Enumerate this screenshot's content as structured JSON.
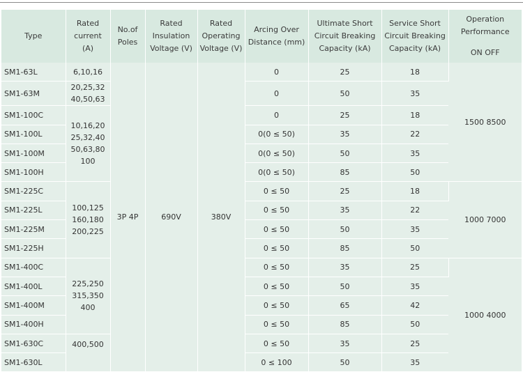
{
  "headers": {
    "type": "Type",
    "rated_current": "Rated current (A)",
    "poles": "No.of Poles",
    "insulation": "Rated Insulation Voltage (V)",
    "operating": "Rated Operating Voltage (V)",
    "arcing": "Arcing Over Distance (mm)",
    "ultimate": "Ultimate Short Circuit Breaking Capacity (kA)",
    "service": "Service Short Circuit Breaking Capacity (kA)",
    "operation": "Operation Performance",
    "operation_sub": "ON OFF"
  },
  "shared": {
    "poles": "3P 4P",
    "insulation": "690V",
    "operating": "380V"
  },
  "currents": {
    "g1a": "6,10,16",
    "g1b": "20,25,32 40,50,63",
    "g2": "10,16,20 25,32,40 50,63,80 100",
    "g3": "100,125 160,180 200,225",
    "g4": "225,250 315,350 400",
    "g5": "400,500"
  },
  "operation": {
    "op1": "1500 8500",
    "op2": "1000 7000",
    "op3": "1000 4000"
  },
  "rows": [
    {
      "type": "SM1-63L",
      "arc": "0",
      "ult": "25",
      "svc": "18"
    },
    {
      "type": "SM1-63M",
      "arc": "0",
      "ult": "50",
      "svc": "35"
    },
    {
      "type": "SM1-100C",
      "arc": "0",
      "ult": "25",
      "svc": "18"
    },
    {
      "type": "SM1-100L",
      "arc": "0(0 ≤ 50)",
      "ult": "35",
      "svc": "22"
    },
    {
      "type": "SM1-100M",
      "arc": "0(0 ≤ 50)",
      "ult": "50",
      "svc": "35"
    },
    {
      "type": "SM1-100H",
      "arc": "0(0 ≤ 50)",
      "ult": "85",
      "svc": "50"
    },
    {
      "type": "SM1-225C",
      "arc": "0 ≤ 50",
      "ult": "25",
      "svc": "18"
    },
    {
      "type": "SM1-225L",
      "arc": "0 ≤ 50",
      "ult": "35",
      "svc": "22"
    },
    {
      "type": "SM1-225M",
      "arc": "0 ≤ 50",
      "ult": "50",
      "svc": "35"
    },
    {
      "type": "SM1-225H",
      "arc": "0 ≤ 50",
      "ult": "85",
      "svc": "50"
    },
    {
      "type": "SM1-400C",
      "arc": "0 ≤ 50",
      "ult": "35",
      "svc": "25"
    },
    {
      "type": "SM1-400L",
      "arc": "0 ≤ 50",
      "ult": "50",
      "svc": "35"
    },
    {
      "type": "SM1-400M",
      "arc": "0 ≤ 50",
      "ult": "65",
      "svc": "42"
    },
    {
      "type": "SM1-400H",
      "arc": "0 ≤ 50",
      "ult": "85",
      "svc": "50"
    },
    {
      "type": "SM1-630C",
      "arc": "0 ≤ 50",
      "ult": "35",
      "svc": "25"
    },
    {
      "type": "SM1-630L",
      "arc": "0 ≤ 100",
      "ult": "50",
      "svc": "35"
    }
  ]
}
